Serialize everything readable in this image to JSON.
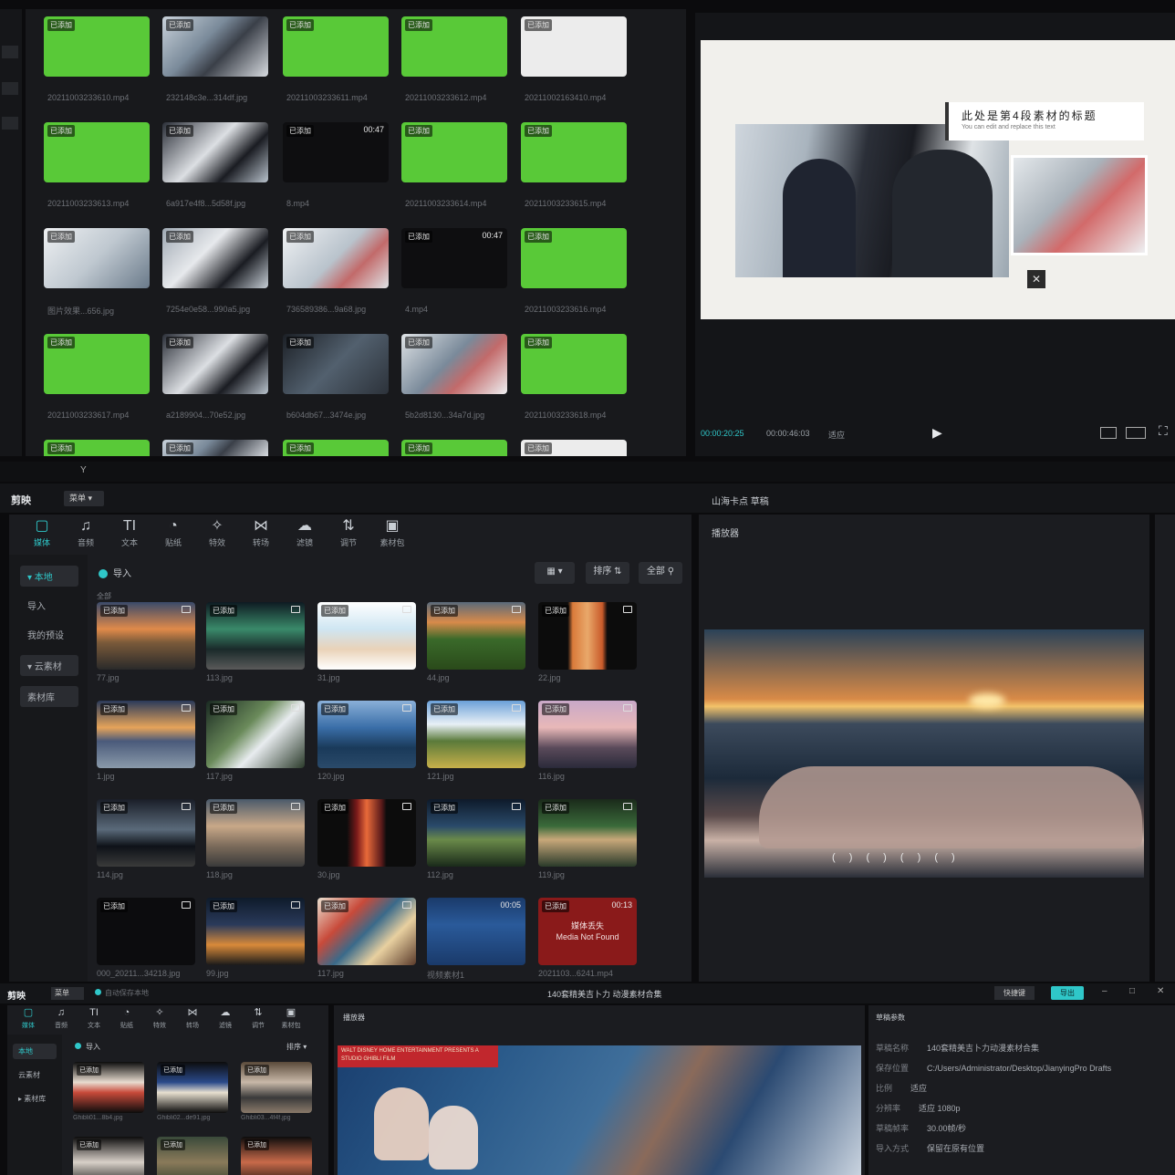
{
  "top": {
    "thumb_tag": "已添加",
    "durations": [
      "00:47",
      "00:47"
    ],
    "files": [
      "20211003233610.mp4",
      "232148c3e...314df.jpg",
      "20211003233611.mp4",
      "20211003233612.mp4",
      "20211002163410.mp4",
      "20211003233613.mp4",
      "6a917e4f8...5d58f.jpg",
      "8.mp4",
      "20211003233614.mp4",
      "20211003233615.mp4",
      "图片效果...656.jpg",
      "7254e0e58...990a5.jpg",
      "736589386...9a68.jpg",
      "4.mp4",
      "20211003233616.mp4",
      "20211003233617.mp4",
      "a2189904...70e52.jpg",
      "b604db67...3474e.jpg",
      "5b2d8130...34a7d.jpg",
      "20211003233618.mp4"
    ],
    "preview_title": "此处是第4段素材的标题",
    "preview_subtitle": "You can edit and replace this text",
    "time_current": "00:00:20:25",
    "time_total": "00:00:46:03",
    "ratio_label": "适应",
    "play_icon": "play-icon"
  },
  "mid": {
    "app_name": "剪映",
    "menu_label": "菜单",
    "project_title": "山海卡点 草稿",
    "toolbar": [
      "媒体",
      "音频",
      "文本",
      "贴纸",
      "特效",
      "转场",
      "滤镜",
      "调节",
      "素材包"
    ],
    "sidebar": [
      "本地",
      "导入",
      "我的预设",
      "云素材",
      "素材库"
    ],
    "import_label": "导入",
    "section_label": "全部",
    "sort_label": "排序",
    "filter_label": "全部",
    "tag": "已添加",
    "files": [
      "77.jpg",
      "113.jpg",
      "31.jpg",
      "44.jpg",
      "22.jpg",
      "1.jpg",
      "117.jpg",
      "120.jpg",
      "121.jpg",
      "116.jpg",
      "114.jpg",
      "118.jpg",
      "30.jpg",
      "112.jpg",
      "119.jpg",
      "000_20211...34218.jpg",
      "99.jpg",
      "117.jpg",
      "视频素材1",
      "2021103...6241.mp4"
    ],
    "media_lost_cn": "媒体丢失",
    "media_lost_en": "Media Not Found",
    "media_lost_time": "00:13",
    "clip_time": "00:05",
    "player_label": "播放器"
  },
  "bottom": {
    "app_name": "剪映",
    "menu_label": "菜单",
    "autosave": "自动保存本地",
    "project_title": "140套精美吉卜力 动漫素材合集",
    "shortcut_label": "快捷键",
    "export_label": "导出",
    "toolbar": [
      "媒体",
      "音频",
      "文本",
      "贴纸",
      "特效",
      "转场",
      "滤镜",
      "调节",
      "素材包"
    ],
    "sidebar": [
      "本地",
      "云素材",
      "素材库"
    ],
    "import_label": "导入",
    "sort_label": "排序",
    "tag": "已添加",
    "files": [
      "Ghibli01...8b4.jpg",
      "Ghibli02...de91.jpg",
      "Ghibli03...4f4f.jpg"
    ],
    "player_label": "播放器",
    "poster_text": "WALT DISNEY HOME ENTERTAINMENT PRESENTS A STUDIO GHIBLI FILM",
    "draft_label": "草稿参数",
    "meta": [
      {
        "k": "草稿名称",
        "v": "140套精美吉卜力动漫素材合集"
      },
      {
        "k": "保存位置",
        "v": "C:/Users/Administrator/Desktop/JianyingPro Drafts"
      },
      {
        "k": "比例",
        "v": "适应"
      },
      {
        "k": "分辨率",
        "v": "适应 1080p"
      },
      {
        "k": "草稿帧率",
        "v": "30.00帧/秒"
      },
      {
        "k": "导入方式",
        "v": "保留在原有位置"
      }
    ]
  }
}
